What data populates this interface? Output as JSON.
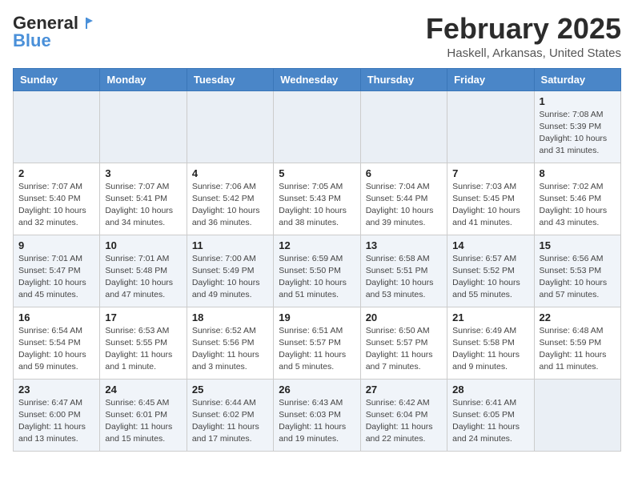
{
  "logo": {
    "general": "General",
    "blue": "Blue"
  },
  "title": "February 2025",
  "location": "Haskell, Arkansas, United States",
  "weekdays": [
    "Sunday",
    "Monday",
    "Tuesday",
    "Wednesday",
    "Thursday",
    "Friday",
    "Saturday"
  ],
  "weeks": [
    [
      {
        "day": "",
        "detail": ""
      },
      {
        "day": "",
        "detail": ""
      },
      {
        "day": "",
        "detail": ""
      },
      {
        "day": "",
        "detail": ""
      },
      {
        "day": "",
        "detail": ""
      },
      {
        "day": "",
        "detail": ""
      },
      {
        "day": "1",
        "detail": "Sunrise: 7:08 AM\nSunset: 5:39 PM\nDaylight: 10 hours and 31 minutes."
      }
    ],
    [
      {
        "day": "2",
        "detail": "Sunrise: 7:07 AM\nSunset: 5:40 PM\nDaylight: 10 hours and 32 minutes."
      },
      {
        "day": "3",
        "detail": "Sunrise: 7:07 AM\nSunset: 5:41 PM\nDaylight: 10 hours and 34 minutes."
      },
      {
        "day": "4",
        "detail": "Sunrise: 7:06 AM\nSunset: 5:42 PM\nDaylight: 10 hours and 36 minutes."
      },
      {
        "day": "5",
        "detail": "Sunrise: 7:05 AM\nSunset: 5:43 PM\nDaylight: 10 hours and 38 minutes."
      },
      {
        "day": "6",
        "detail": "Sunrise: 7:04 AM\nSunset: 5:44 PM\nDaylight: 10 hours and 39 minutes."
      },
      {
        "day": "7",
        "detail": "Sunrise: 7:03 AM\nSunset: 5:45 PM\nDaylight: 10 hours and 41 minutes."
      },
      {
        "day": "8",
        "detail": "Sunrise: 7:02 AM\nSunset: 5:46 PM\nDaylight: 10 hours and 43 minutes."
      }
    ],
    [
      {
        "day": "9",
        "detail": "Sunrise: 7:01 AM\nSunset: 5:47 PM\nDaylight: 10 hours and 45 minutes."
      },
      {
        "day": "10",
        "detail": "Sunrise: 7:01 AM\nSunset: 5:48 PM\nDaylight: 10 hours and 47 minutes."
      },
      {
        "day": "11",
        "detail": "Sunrise: 7:00 AM\nSunset: 5:49 PM\nDaylight: 10 hours and 49 minutes."
      },
      {
        "day": "12",
        "detail": "Sunrise: 6:59 AM\nSunset: 5:50 PM\nDaylight: 10 hours and 51 minutes."
      },
      {
        "day": "13",
        "detail": "Sunrise: 6:58 AM\nSunset: 5:51 PM\nDaylight: 10 hours and 53 minutes."
      },
      {
        "day": "14",
        "detail": "Sunrise: 6:57 AM\nSunset: 5:52 PM\nDaylight: 10 hours and 55 minutes."
      },
      {
        "day": "15",
        "detail": "Sunrise: 6:56 AM\nSunset: 5:53 PM\nDaylight: 10 hours and 57 minutes."
      }
    ],
    [
      {
        "day": "16",
        "detail": "Sunrise: 6:54 AM\nSunset: 5:54 PM\nDaylight: 10 hours and 59 minutes."
      },
      {
        "day": "17",
        "detail": "Sunrise: 6:53 AM\nSunset: 5:55 PM\nDaylight: 11 hours and 1 minute."
      },
      {
        "day": "18",
        "detail": "Sunrise: 6:52 AM\nSunset: 5:56 PM\nDaylight: 11 hours and 3 minutes."
      },
      {
        "day": "19",
        "detail": "Sunrise: 6:51 AM\nSunset: 5:57 PM\nDaylight: 11 hours and 5 minutes."
      },
      {
        "day": "20",
        "detail": "Sunrise: 6:50 AM\nSunset: 5:57 PM\nDaylight: 11 hours and 7 minutes."
      },
      {
        "day": "21",
        "detail": "Sunrise: 6:49 AM\nSunset: 5:58 PM\nDaylight: 11 hours and 9 minutes."
      },
      {
        "day": "22",
        "detail": "Sunrise: 6:48 AM\nSunset: 5:59 PM\nDaylight: 11 hours and 11 minutes."
      }
    ],
    [
      {
        "day": "23",
        "detail": "Sunrise: 6:47 AM\nSunset: 6:00 PM\nDaylight: 11 hours and 13 minutes."
      },
      {
        "day": "24",
        "detail": "Sunrise: 6:45 AM\nSunset: 6:01 PM\nDaylight: 11 hours and 15 minutes."
      },
      {
        "day": "25",
        "detail": "Sunrise: 6:44 AM\nSunset: 6:02 PM\nDaylight: 11 hours and 17 minutes."
      },
      {
        "day": "26",
        "detail": "Sunrise: 6:43 AM\nSunset: 6:03 PM\nDaylight: 11 hours and 19 minutes."
      },
      {
        "day": "27",
        "detail": "Sunrise: 6:42 AM\nSunset: 6:04 PM\nDaylight: 11 hours and 22 minutes."
      },
      {
        "day": "28",
        "detail": "Sunrise: 6:41 AM\nSunset: 6:05 PM\nDaylight: 11 hours and 24 minutes."
      },
      {
        "day": "",
        "detail": ""
      }
    ]
  ]
}
